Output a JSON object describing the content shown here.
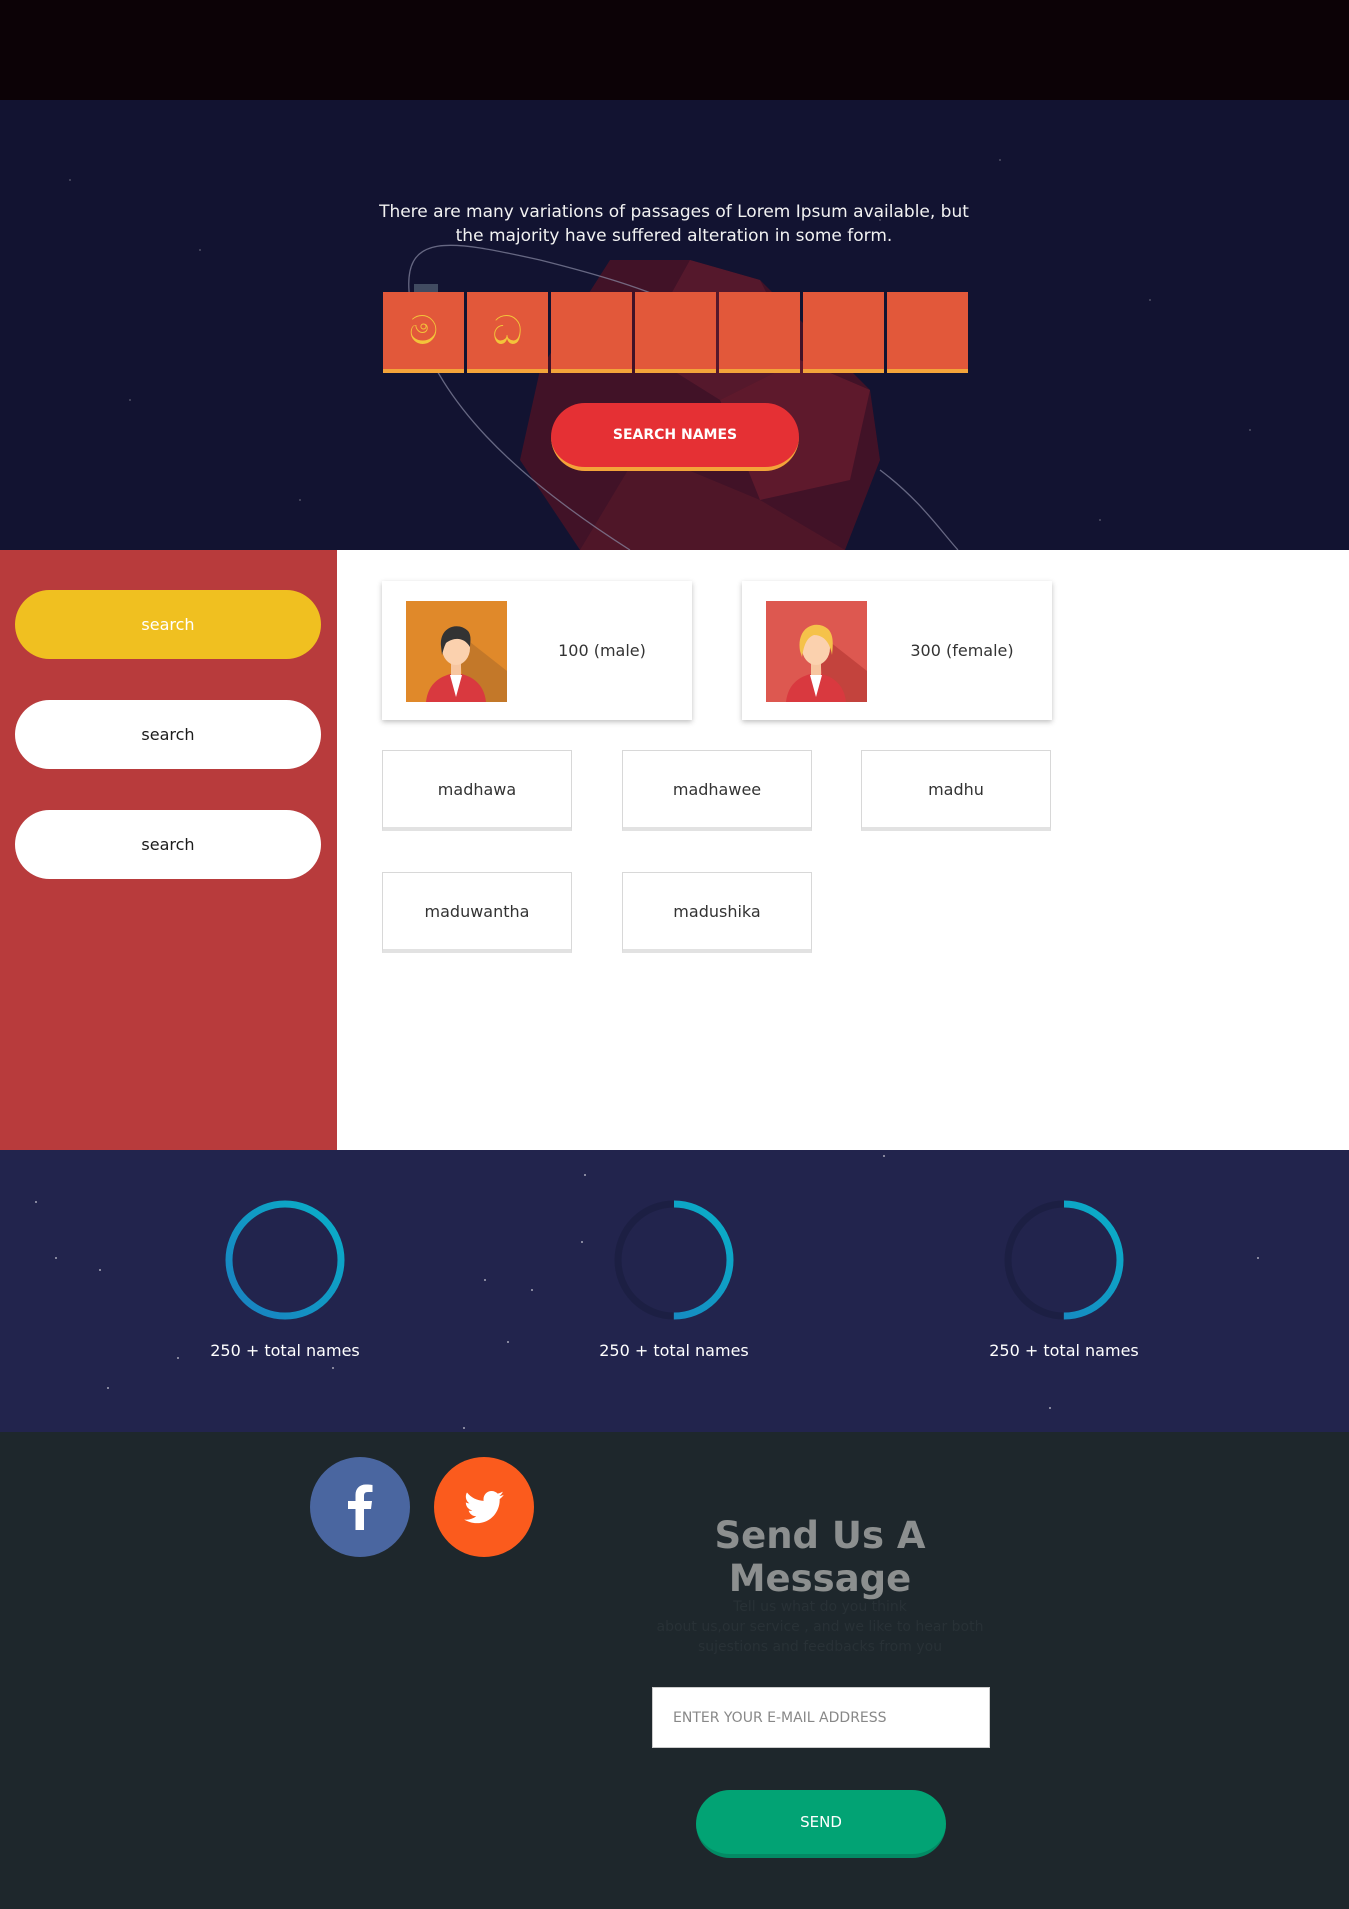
{
  "hero": {
    "text": "There are many variations of passages of Lorem Ipsum available, but the majority have suffered alteration in some form.",
    "letters": [
      "ම",
      "ධ",
      "",
      "",
      "",
      "",
      ""
    ],
    "search_button": "SEARCH NAMES"
  },
  "sidebar": {
    "buttons": [
      "search",
      "search",
      "search"
    ]
  },
  "gender": {
    "male": "100 (male)",
    "female": "300 (female)"
  },
  "names": [
    "madhawa",
    "madhawee",
    "madhu",
    "maduwantha",
    "madushika"
  ],
  "stats": [
    {
      "label": "250 + total names",
      "progress": 1.0
    },
    {
      "label": "250 + total names",
      "progress": 0.5
    },
    {
      "label": "250 + total names",
      "progress": 0.5
    }
  ],
  "footer": {
    "title": "Send Us A Message",
    "subtitle_lines": [
      "Tell us what do you think",
      "about us,our service , and we like to hear both",
      "sujestions and feedbacks from you"
    ],
    "email_placeholder": "ENTER YOUR E-MAIL ADDRESS",
    "send_label": "SEND",
    "social": [
      "facebook-icon",
      "twitter-icon"
    ]
  },
  "colors": {
    "accent_orange": "#e2583a",
    "accent_red": "#e53034",
    "sidebar_red": "#b83b3c",
    "active_yellow": "#f0c020",
    "ring_blue": "#0a9ec0",
    "send_green": "#02a374"
  }
}
